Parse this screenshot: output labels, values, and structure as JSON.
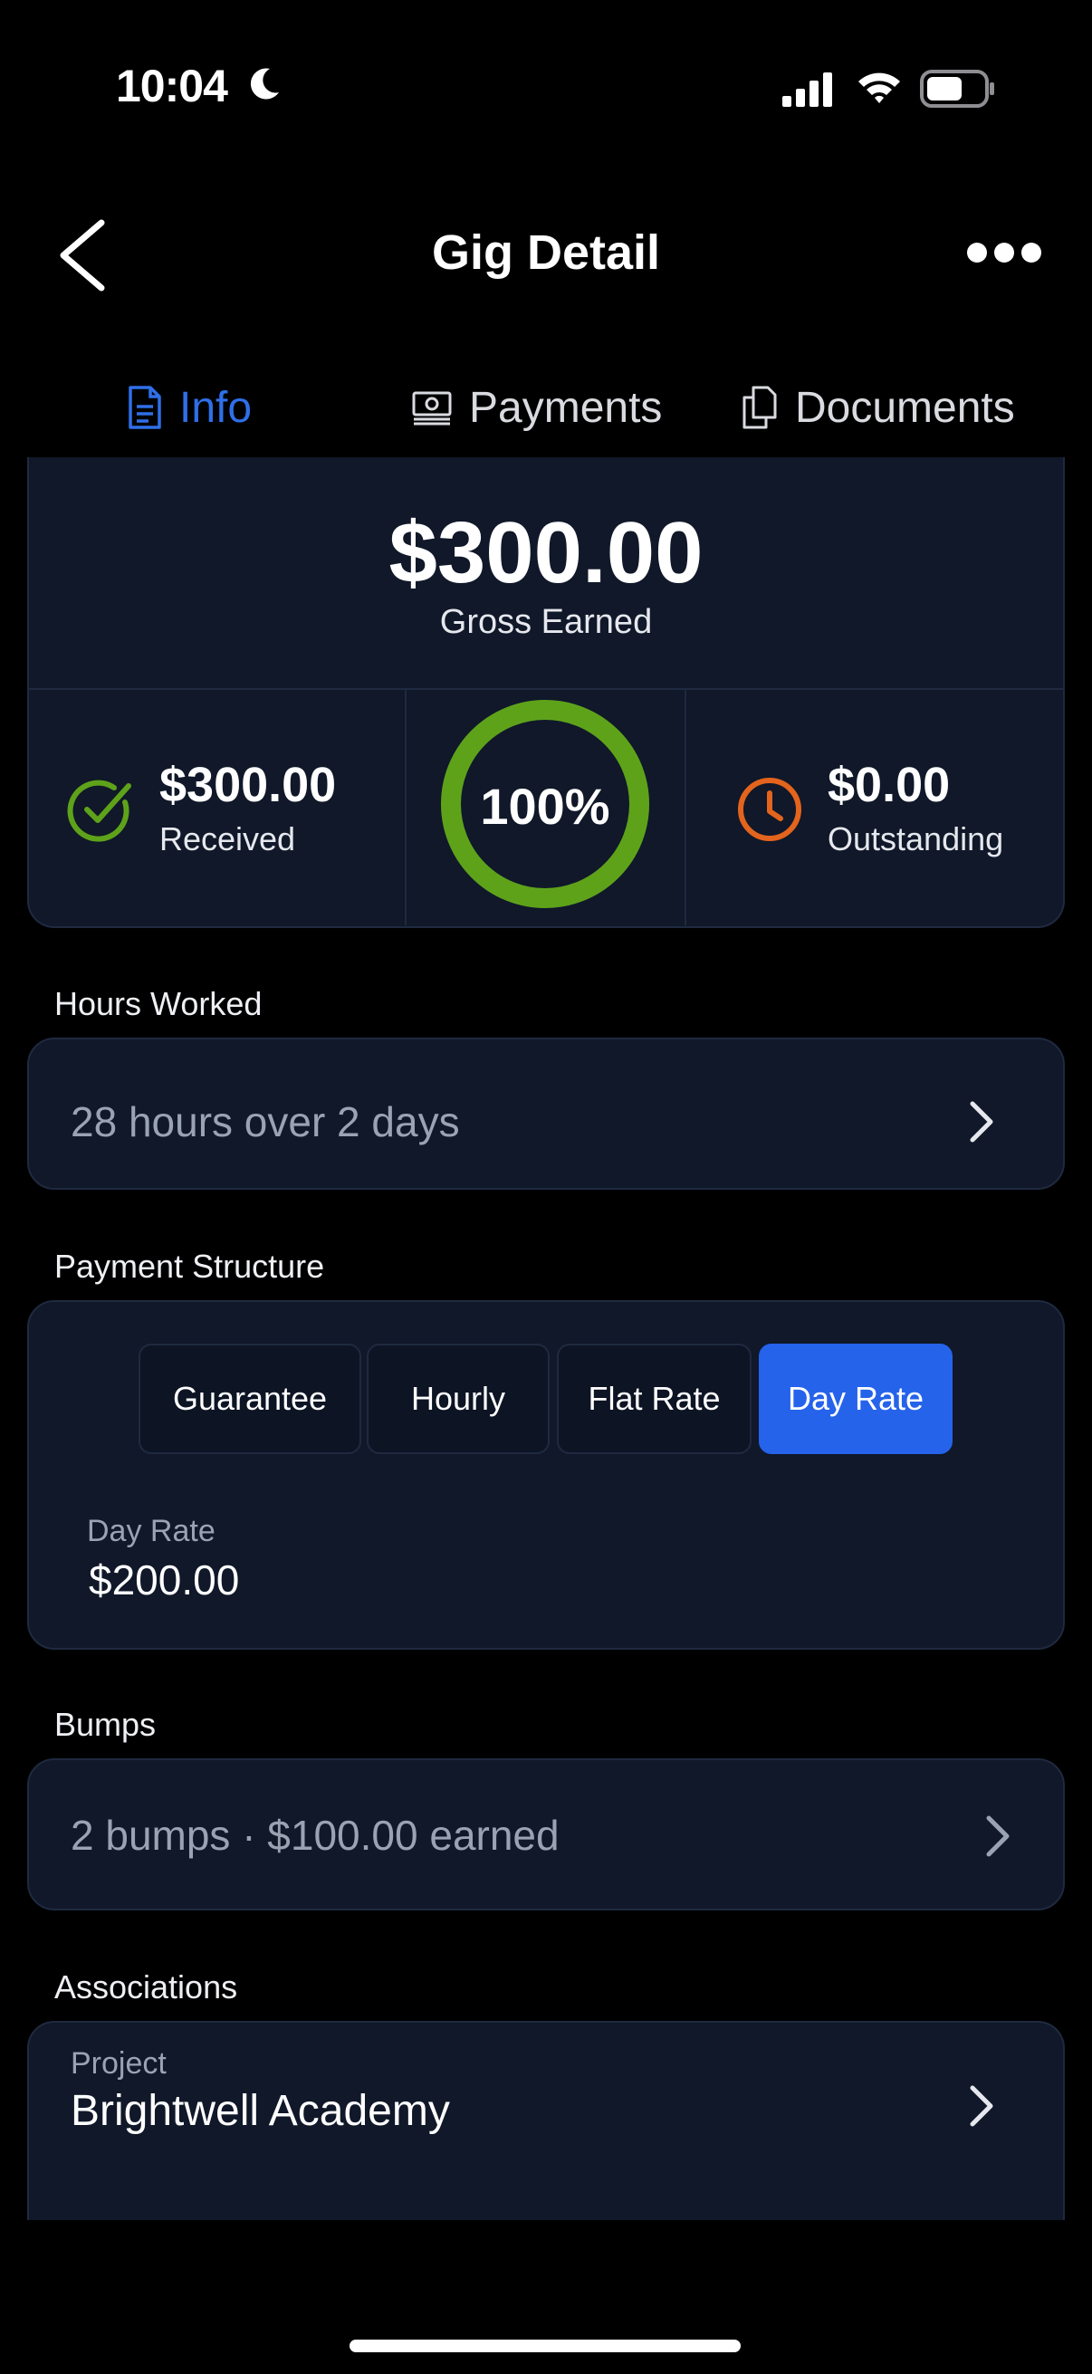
{
  "status_bar": {
    "time": "10:04"
  },
  "header": {
    "title": "Gig Detail"
  },
  "tabs": [
    {
      "label": "Info",
      "icon": "document-icon",
      "active": true
    },
    {
      "label": "Payments",
      "icon": "cash-icon",
      "active": false
    },
    {
      "label": "Documents",
      "icon": "files-icon",
      "active": false
    }
  ],
  "earnings": {
    "gross_value": "$300.00",
    "gross_label": "Gross Earned",
    "received_value": "$300.00",
    "received_label": "Received",
    "progress_text": "100%",
    "progress_fraction": 1.0,
    "outstanding_value": "$0.00",
    "outstanding_label": "Outstanding"
  },
  "hours": {
    "label": "Hours Worked",
    "value": "28 hours over 2 days"
  },
  "payment_structure": {
    "label": "Payment Structure",
    "options": [
      "Guarantee",
      "Hourly",
      "Flat Rate",
      "Day Rate"
    ],
    "selected": "Day Rate",
    "field_label": "Day Rate",
    "field_value": "$200.00"
  },
  "bumps": {
    "label": "Bumps",
    "value": "2 bumps · $100.00 earned"
  },
  "associations": {
    "label": "Associations",
    "project_label": "Project",
    "project_value": "Brightwell Academy"
  },
  "colors": {
    "accent": "#2f6fe8",
    "success": "#5ea21a",
    "warning": "#e3641c",
    "card": "#101829"
  }
}
